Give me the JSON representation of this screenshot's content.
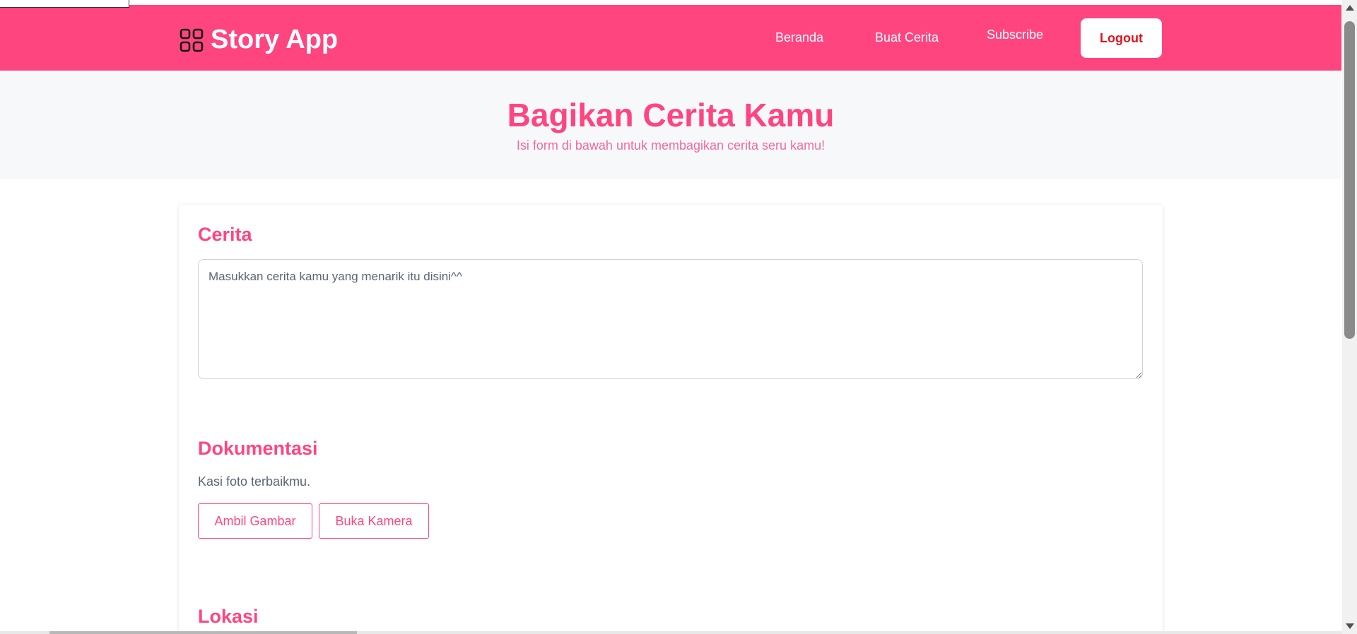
{
  "header": {
    "brand": "Story App",
    "brand_icon": "grid-icon",
    "nav": {
      "home": "Beranda",
      "create": "Buat Cerita",
      "subscribe": "Subscribe"
    },
    "logout": "Logout"
  },
  "hero": {
    "title": "Bagikan Cerita Kamu",
    "subtitle": "Isi form di bawah untuk membagikan cerita seru kamu!"
  },
  "form": {
    "story": {
      "title": "Cerita",
      "placeholder": "Masukkan cerita kamu yang menarik itu disini^^"
    },
    "documentation": {
      "title": "Dokumentasi",
      "description": "Kasi foto terbaikmu.",
      "pick_image": "Ambil Gambar",
      "open_camera": "Buka Kamera"
    },
    "location": {
      "title": "Lokasi"
    }
  },
  "colors": {
    "primary": "#ff4580",
    "logout_text": "#e0141e",
    "hero_bg": "#f7f8fa",
    "muted_text": "#5a6575"
  }
}
